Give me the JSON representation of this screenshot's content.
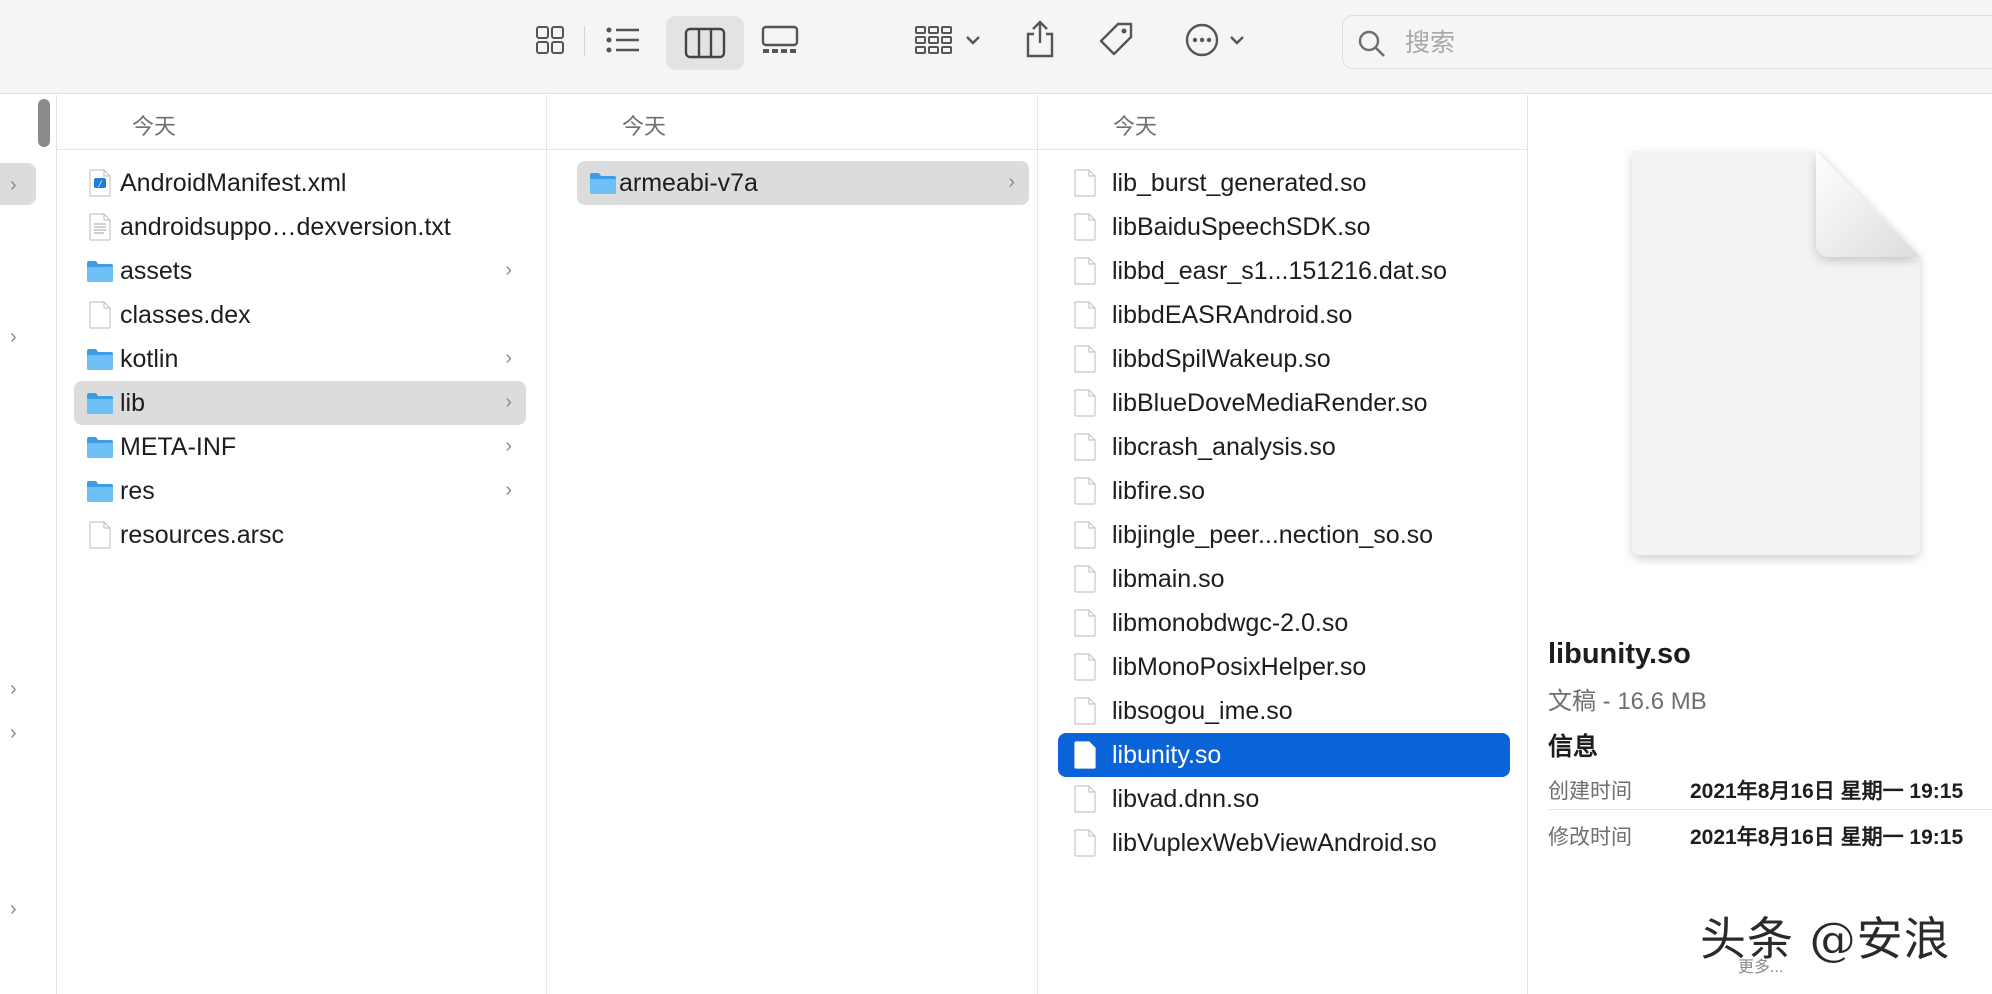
{
  "toolbar": {
    "views": [
      {
        "name": "icon-view",
        "active": false
      },
      {
        "name": "list-view",
        "active": false
      },
      {
        "name": "column-view",
        "active": true
      },
      {
        "name": "gallery-view",
        "active": false
      }
    ],
    "search_placeholder": "搜索"
  },
  "columns": [
    {
      "header": "今天",
      "items": [
        {
          "name": "AndroidManifest.xml",
          "icon": "xml-file-icon",
          "folder": false
        },
        {
          "name": "androidsuppo…dexversion.txt",
          "icon": "text-file-icon",
          "folder": false
        },
        {
          "name": "assets",
          "icon": "folder-icon",
          "folder": true
        },
        {
          "name": "classes.dex",
          "icon": "document-icon",
          "folder": false
        },
        {
          "name": "kotlin",
          "icon": "folder-icon",
          "folder": true
        },
        {
          "name": "lib",
          "icon": "folder-icon",
          "folder": true,
          "selected": true
        },
        {
          "name": "META-INF",
          "icon": "folder-icon",
          "folder": true
        },
        {
          "name": "res",
          "icon": "folder-icon",
          "folder": true
        },
        {
          "name": "resources.arsc",
          "icon": "document-icon",
          "folder": false
        }
      ]
    },
    {
      "header": "今天",
      "items": [
        {
          "name": "armeabi-v7a",
          "icon": "folder-icon",
          "folder": true,
          "selected": true
        }
      ]
    },
    {
      "header": "今天",
      "items": [
        {
          "name": "lib_burst_generated.so"
        },
        {
          "name": "libBaiduSpeechSDK.so"
        },
        {
          "name": "libbd_easr_s1...151216.dat.so"
        },
        {
          "name": "libbdEASRAndroid.so"
        },
        {
          "name": "libbdSpilWakeup.so"
        },
        {
          "name": "libBlueDoveMediaRender.so"
        },
        {
          "name": "libcrash_analysis.so"
        },
        {
          "name": "libfire.so"
        },
        {
          "name": "libjingle_peer...nection_so.so"
        },
        {
          "name": "libmain.so"
        },
        {
          "name": "libmonobdwgc-2.0.so"
        },
        {
          "name": "libMonoPosixHelper.so"
        },
        {
          "name": "libsogou_ime.so"
        },
        {
          "name": "libunity.so",
          "selected": true
        },
        {
          "name": "libvad.dnn.so"
        },
        {
          "name": "libVuplexWebViewAndroid.so"
        }
      ]
    }
  ],
  "preview": {
    "name": "libunity.so",
    "kind": "文稿 - 16.6 MB",
    "info_title": "信息",
    "created_label": "创建时间",
    "created_value": "2021年8月16日 星期一 19:15",
    "modified_label": "修改时间",
    "modified_value": "2021年8月16日 星期一 19:15",
    "watermark": "头条 @安浪",
    "more": "更多..."
  },
  "colors": {
    "selection_blue": "#0a63d8",
    "selection_gray": "#dcdcdc",
    "folder_blue": "#5ab4f0"
  }
}
